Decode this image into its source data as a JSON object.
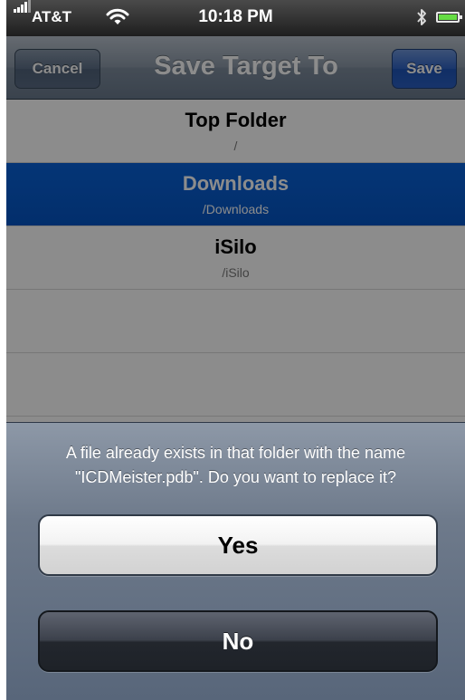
{
  "status_bar": {
    "carrier": "AT&T",
    "time": "10:18 PM",
    "signal_icon": "signal-bars-icon",
    "wifi_icon": "wifi-icon",
    "bluetooth_icon": "bluetooth-icon",
    "battery_icon": "battery-icon",
    "battery_level": 1.0
  },
  "nav": {
    "title": "Save Target To",
    "cancel_label": "Cancel",
    "save_label": "Save"
  },
  "folders": [
    {
      "name": "Top Folder",
      "path": "/",
      "selected": false
    },
    {
      "name": "Downloads",
      "path": "/Downloads",
      "selected": true
    },
    {
      "name": "iSilo",
      "path": "/iSilo",
      "selected": false
    }
  ],
  "action_sheet": {
    "message_line1": "A file already exists in that folder with the name",
    "message_line2": "\"ICDMeister.pdb\". Do you want to replace it?",
    "yes_label": "Yes",
    "no_label": "No"
  },
  "colors": {
    "selection": "#0a62d8",
    "nav_bar": "#7e8c9d",
    "save_button": "#2f63c4",
    "battery_fill": "#66dd44"
  }
}
